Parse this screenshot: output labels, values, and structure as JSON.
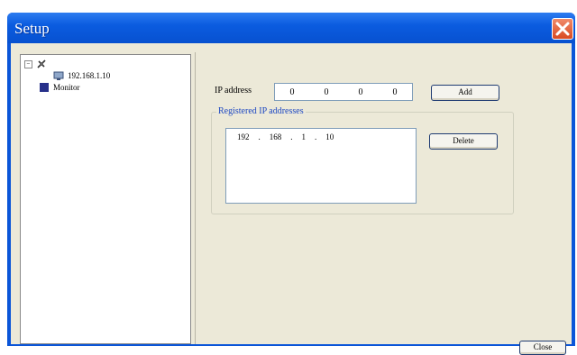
{
  "window": {
    "title": "Setup"
  },
  "tree": {
    "root_expander": "−",
    "device_label": "192.168.1.10",
    "monitor_label": "Monitor"
  },
  "form": {
    "ip_label": "IP address",
    "ip_octets": [
      "0",
      "0",
      "0",
      "0"
    ],
    "add_label": "Add",
    "registered_label": "Registered IP addresses",
    "delete_label": "Delete"
  },
  "registered": [
    {
      "octets": [
        "192",
        "168",
        "1",
        "10"
      ]
    }
  ],
  "footer": {
    "close_label": "Close"
  },
  "colors": {
    "titlebar": "#0b5ce0",
    "dialog_bg": "#ece9d8",
    "group_label": "#1b46c2"
  }
}
